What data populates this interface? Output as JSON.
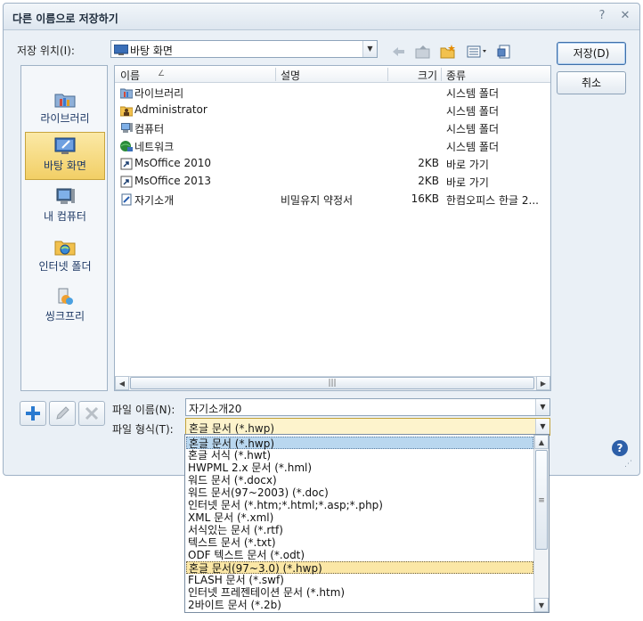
{
  "window": {
    "title": "다른 이름으로 저장하기",
    "help_glyph": "?",
    "close_glyph": "✕"
  },
  "location": {
    "label": "저장 위치(I):",
    "value": "바탕 화면"
  },
  "places": [
    {
      "label": "라이브러리",
      "icon": "library-icon"
    },
    {
      "label": "바탕 화면",
      "icon": "desktop-icon"
    },
    {
      "label": "내 컴퓨터",
      "icon": "computer-icon"
    },
    {
      "label": "인터넷 폴더",
      "icon": "internet-folder-icon"
    },
    {
      "label": "씽크프리",
      "icon": "thinkfree-icon"
    }
  ],
  "columns": {
    "name": "이름",
    "desc": "설명",
    "size": "크기",
    "type": "종류"
  },
  "files": [
    {
      "name": "라이브러리",
      "desc": "",
      "size": "",
      "type": "시스템 폴더",
      "icon": "library-icon"
    },
    {
      "name": "Administrator",
      "desc": "",
      "size": "",
      "type": "시스템 폴더",
      "icon": "user-folder-icon"
    },
    {
      "name": "컴퓨터",
      "desc": "",
      "size": "",
      "type": "시스템 폴더",
      "icon": "computer-icon"
    },
    {
      "name": "네트워크",
      "desc": "",
      "size": "",
      "type": "시스템 폴더",
      "icon": "network-icon"
    },
    {
      "name": "MsOffice 2010",
      "desc": "",
      "size": "2KB",
      "type": "바로 가기",
      "icon": "shortcut-icon"
    },
    {
      "name": "MsOffice 2013",
      "desc": "",
      "size": "2KB",
      "type": "바로 가기",
      "icon": "shortcut-icon"
    },
    {
      "name": "자기소개",
      "desc": "비밀유지 약정서",
      "size": "16KB",
      "type": "한컴오피스 한글 2...",
      "icon": "hwp-file-icon"
    }
  ],
  "filename": {
    "label": "파일 이름(N):",
    "value": "자기소개20"
  },
  "filetype": {
    "label": "파일 형식(T):",
    "value": "혼글 문서 (*.hwp)"
  },
  "buttons": {
    "save": "저장(D)",
    "cancel": "취소"
  },
  "filetype_options": [
    "혼글 문서 (*.hwp)",
    "혼글 서식 (*.hwt)",
    "HWPML 2.x 문서 (*.hml)",
    "워드 문서 (*.docx)",
    "워드 문서(97~2003) (*.doc)",
    "인터넷 문서 (*.htm;*.html;*.asp;*.php)",
    "XML 문서 (*.xml)",
    "서식있는 문서 (*.rtf)",
    "텍스트 문서 (*.txt)",
    "ODF 텍스트 문서 (*.odt)",
    "혼글 문서(97~3.0) (*.hwp)",
    "FLASH 문서 (*.swf)",
    "인터넷 프레젠테이션 문서 (*.htm)",
    "2바이트 문서 (*.2b)"
  ],
  "colors": {
    "selection": "#f2cf66",
    "accent": "#1f5fae"
  }
}
